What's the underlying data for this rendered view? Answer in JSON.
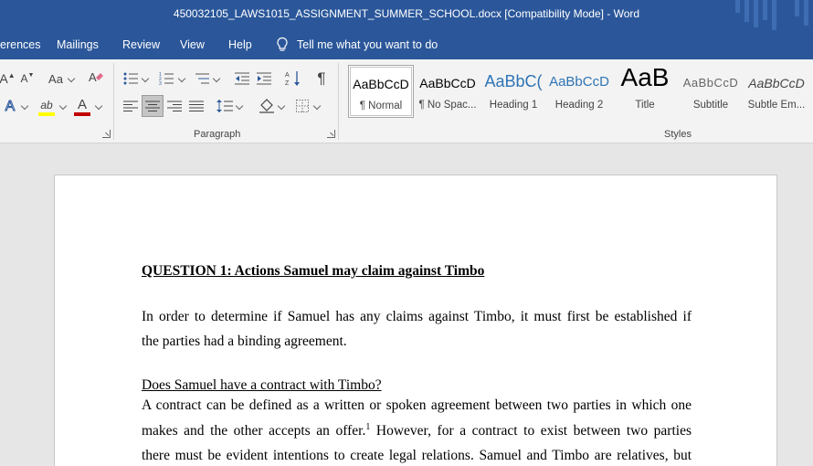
{
  "window": {
    "title": "450032105_LAWS1015_ASSIGNMENT_SUMMER_SCHOOL.docx [Compatibility Mode]  -  Word"
  },
  "tabs": [
    {
      "label": "erences"
    },
    {
      "label": "Mailings"
    },
    {
      "label": "Review"
    },
    {
      "label": "View"
    },
    {
      "label": "Help"
    }
  ],
  "tell_me": {
    "text": "Tell me what you want to do",
    "icon": "lightbulb-icon"
  },
  "ribbon": {
    "paragraph_label": "Paragraph",
    "styles_label": "Styles",
    "font_buttons": {
      "grow": "A",
      "shrink": "A",
      "change_case": "Aa",
      "text_effects": "A",
      "font_color": "A",
      "highlight": "ab"
    },
    "colors": {
      "font_color_bar": "#c00000",
      "highlight_bar": "#ffff00",
      "selected_align": "#c5c5c5"
    },
    "styles": [
      {
        "sample": "AaBbCcD",
        "name": "¶ Normal"
      },
      {
        "sample": "AaBbCcD",
        "name": "¶ No Spac..."
      },
      {
        "sample": "AaBbC(",
        "name": "Heading 1"
      },
      {
        "sample": "AaBbCcD",
        "name": "Heading 2"
      },
      {
        "sample": "AaB",
        "name": "Title"
      },
      {
        "sample": "AaBbCcD",
        "name": "Subtitle"
      },
      {
        "sample": "AaBbCcD",
        "name": "Subtle Em..."
      }
    ]
  },
  "document": {
    "heading": "QUESTION 1: Actions Samuel may claim against Timbo",
    "para1_line1": "In order to determine if Samuel has any claims against Timbo, it must first be established if",
    "para1_line2": "the parties had a binding agreement.",
    "subheading": "Does Samuel have a contract with Timbo?",
    "para2_line1": "A contract can be defined as a written or spoken agreement between two parties in which one",
    "para2_line2a": "makes and the other accepts an offer.",
    "footnote_ref": "1",
    "para2_line2b": " However, for a contract to exist between two parties",
    "para2_line3": "there must be evident intentions to create legal relations. Samuel and Timbo are relatives, but"
  }
}
